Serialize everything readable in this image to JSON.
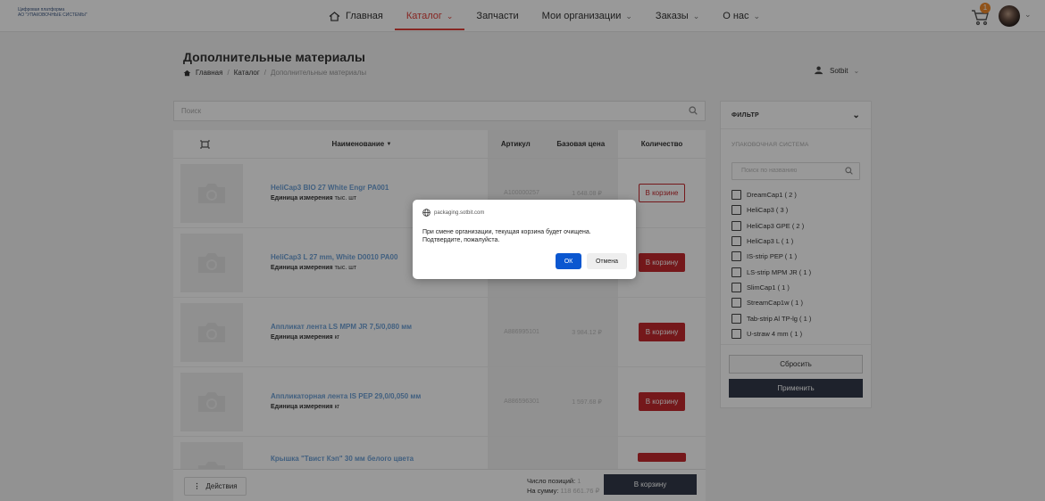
{
  "brand": {
    "line1": "Цифровая платформа",
    "line2": "АО \"УПАКОВОЧНЫЕ СИСТЕМЫ\""
  },
  "nav": {
    "items": [
      {
        "label": "Главная",
        "icon": "home-icon"
      },
      {
        "label": "Каталог",
        "active": true
      },
      {
        "label": "Запчасти"
      },
      {
        "label": "Мои организации"
      },
      {
        "label": "Заказы"
      },
      {
        "label": "О нас"
      }
    ]
  },
  "header": {
    "cart_count": "1",
    "accent": "#e0403a"
  },
  "page": {
    "title": "Дополнительные материалы",
    "breadcrumb": {
      "home": "Главная",
      "sep": "/",
      "catalog": "Каталог",
      "current": "Дополнительные материалы"
    },
    "user": "Sotbit"
  },
  "search": {
    "placeholder": "Поиск"
  },
  "table": {
    "columns": {
      "name": "Наименование",
      "article": "Артикул",
      "price": "Базовая цена",
      "qty": "Количество"
    },
    "unit_label": "Единица измерения",
    "rows": [
      {
        "name": "HeliCap3 BIO 27 White Engr PA001",
        "unit": "тыс. шт",
        "article": "A100000257",
        "price": "1 648.08 ₽",
        "action": "В корзине"
      },
      {
        "name": "HeliCap3 L 27 mm, White D0010 PA00",
        "unit": "тыс. шт",
        "article": "",
        "price": "",
        "action": "В корзину"
      },
      {
        "name": "Аппликат лента LS MPM JR 7,5/0,080 мм",
        "unit": "кг",
        "article": "A886995101",
        "price": "3 984.12 ₽",
        "action": "В корзину"
      },
      {
        "name": "Аппликаторная лента IS PEP 29,0/0,050 мм",
        "unit": "кг",
        "article": "A886596301",
        "price": "1 597.68 ₽",
        "action": "В корзину"
      },
      {
        "name": "Крышка \"Твист Кэп\" 30 мм белого цвета",
        "unit": "",
        "article": "",
        "price": "",
        "action": ""
      }
    ]
  },
  "footer": {
    "actions_label": "Действия",
    "count_label": "Число позиций:",
    "count_value": "1",
    "sum_label": "На сумму:",
    "sum_value": "118 661.76 ₽",
    "cart_button": "В корзину"
  },
  "filter": {
    "title": "ФИЛЬТР",
    "section": "УПАКОВОЧНАЯ СИСТЕМА",
    "search_placeholder": "Поиск по названию",
    "items": [
      "DreamCap1 ( 2 )",
      "HeliCap3 ( 3 )",
      "HeliCap3 GPE ( 2 )",
      "HeliCap3 L ( 1 )",
      "IS-strip PEP ( 1 )",
      "LS-strip MPM JR ( 1 )",
      "SlimCap1 ( 1 )",
      "StreamCap1w ( 1 )",
      "Tab-strip Al TP-lg ( 1 )",
      "U-straw 4 mm ( 1 )"
    ],
    "reset": "Сбросить",
    "apply": "Применить"
  },
  "dialog": {
    "origin": "packaging.sotbit.com",
    "message": "При смене организации, текущая корзина будет очищена. Подтвердите, пожалуйста.",
    "ok": "ОК",
    "cancel": "Отмена",
    "ok_color": "#0b57d0"
  }
}
